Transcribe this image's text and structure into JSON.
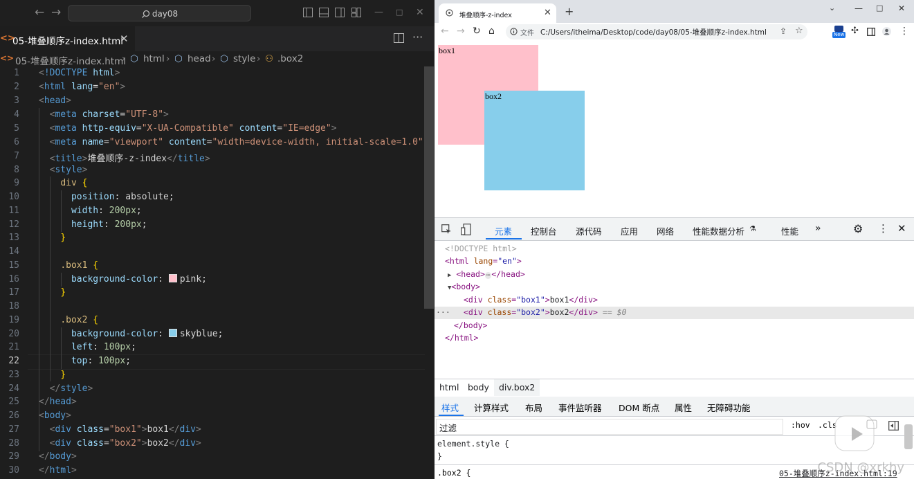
{
  "vscode": {
    "search": "day08",
    "tab_title": "05-堆叠顺序z-index.html",
    "breadcrumb": {
      "file": "05-堆叠顺序z-index.html",
      "html": "html",
      "head": "head",
      "style": "style",
      "selector": ".box2"
    },
    "current_line": 22,
    "lines": [
      "1",
      "2",
      "3",
      "4",
      "5",
      "6",
      "7",
      "8",
      "9",
      "10",
      "11",
      "12",
      "13",
      "14",
      "15",
      "16",
      "17",
      "18",
      "19",
      "20",
      "21",
      "22",
      "23",
      "24",
      "25",
      "26",
      "27",
      "28",
      "29",
      "30"
    ]
  },
  "browser": {
    "tab_title": "堆叠顺序-z-index",
    "file_label": "文件",
    "url": "C:/Users/itheima/Desktop/code/day08/05-堆叠顺序z-index.html",
    "box1_label": "box1",
    "box2_label": "box2",
    "new_badge": "New",
    "devtools": {
      "tabs": [
        "元素",
        "控制台",
        "源代码",
        "应用",
        "网络",
        "性能数据分析",
        "性能"
      ],
      "more": "»",
      "crumbs": [
        "html",
        "body",
        "div.box2"
      ],
      "styles_tabs": [
        "样式",
        "计算样式",
        "布局",
        "事件监听器",
        "DOM 断点",
        "属性",
        "无障碍功能"
      ],
      "filter_placeholder": "过滤",
      "hov": ":hov",
      "cls": ".cls",
      "element_style": "element.style {",
      "close_brace": "}",
      "rule_selector": ".box2 {",
      "rule_source": "05-堆叠顺序z-index.html:19",
      "selected_marker": "== $0"
    }
  },
  "watermark": "CSDN @xrkhy",
  "colors": {
    "pink": "#ffc0cb",
    "skyblue": "#87ceeb",
    "accent": "#1a73e8"
  }
}
